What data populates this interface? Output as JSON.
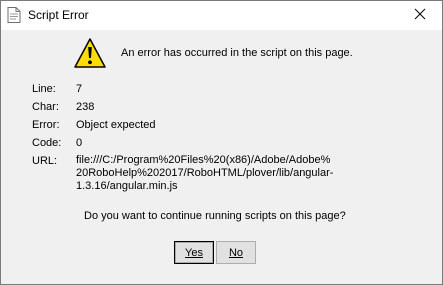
{
  "window": {
    "title": "Script Error",
    "close_glyph": "✕"
  },
  "dialog": {
    "message": "An error has occurred in the script on this page.",
    "fields": [
      {
        "label": "Line:",
        "value": "7"
      },
      {
        "label": "Char:",
        "value": "238"
      },
      {
        "label": "Error:",
        "value": "Object expected"
      },
      {
        "label": "Code:",
        "value": "0"
      }
    ],
    "url_label": "URL:",
    "url_lines": [
      "file:///C:/Program%20Files%20(x86)/Adobe/Adobe%",
      "20RoboHelp%202017/RoboHTML/plover/lib/angular-",
      "1.3.16/angular.min.js"
    ],
    "question": "Do you want to continue running scripts on this page?"
  },
  "buttons": {
    "yes_label": "Yes",
    "no_label": "No"
  },
  "icons": {
    "title": "script-page-icon",
    "warning": "warning-triangle-icon",
    "close": "close-icon"
  },
  "colors": {
    "warning_fill": "#ffdd00",
    "warning_stroke": "#000000"
  }
}
